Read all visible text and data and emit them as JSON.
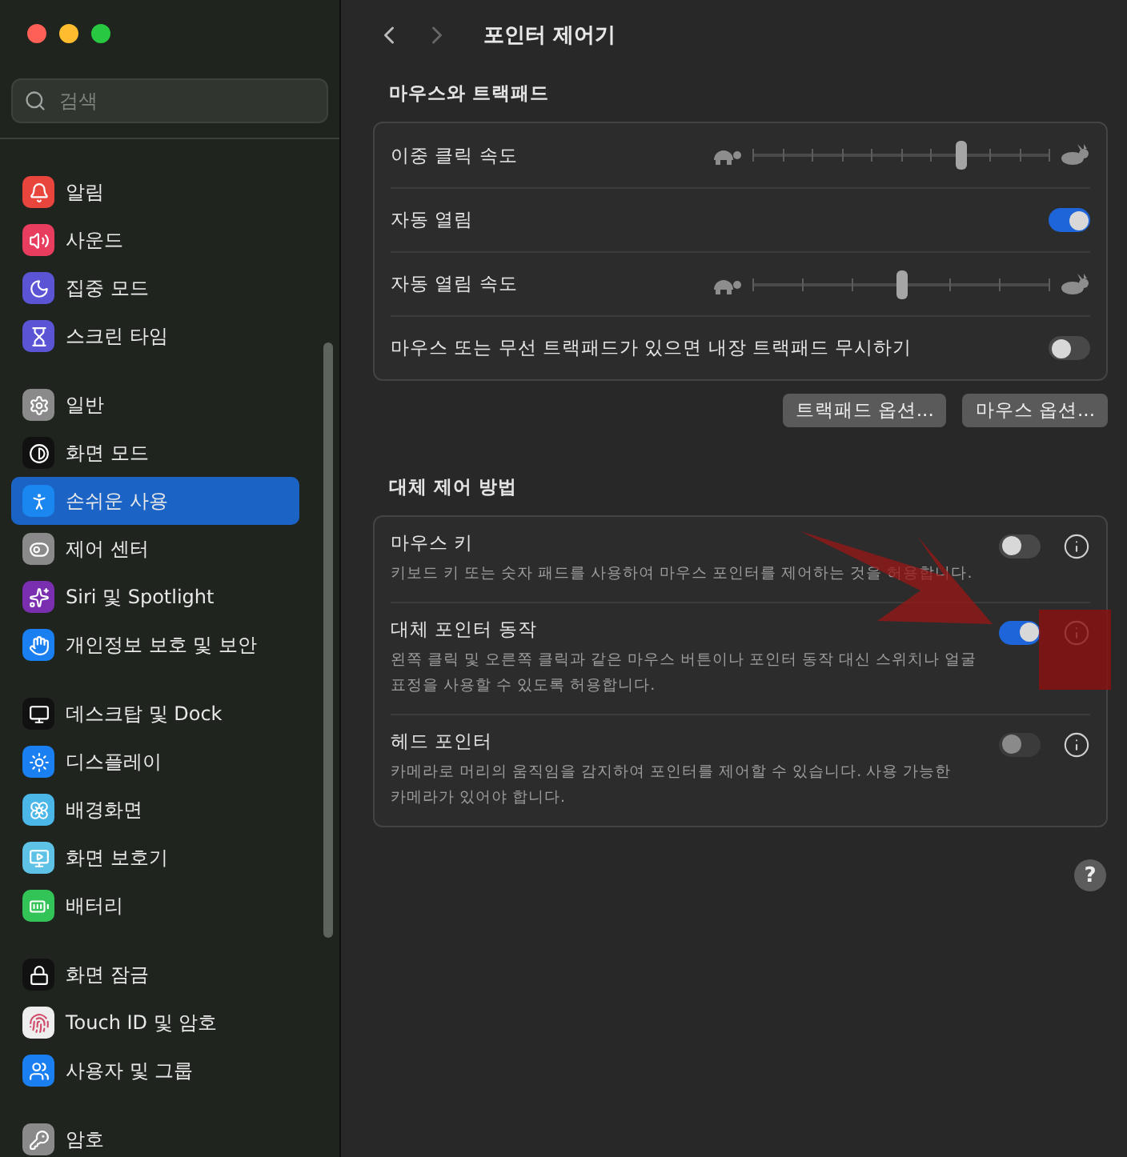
{
  "window": {
    "title": "포인터 제어기"
  },
  "sidebar": {
    "search": {
      "placeholder": "검색"
    },
    "groups": [
      [
        {
          "label": "알림",
          "selected": false
        },
        {
          "label": "사운드",
          "selected": false
        },
        {
          "label": "집중 모드",
          "selected": false
        },
        {
          "label": "스크린 타임",
          "selected": false
        }
      ],
      [
        {
          "label": "일반",
          "selected": false
        },
        {
          "label": "화면 모드",
          "selected": false
        },
        {
          "label": "손쉬운 사용",
          "selected": true
        },
        {
          "label": "제어 센터",
          "selected": false
        },
        {
          "label": "Siri 및 Spotlight",
          "selected": false
        },
        {
          "label": "개인정보 보호 및 보안",
          "selected": false
        }
      ],
      [
        {
          "label": "데스크탑 및 Dock",
          "selected": false
        },
        {
          "label": "디스플레이",
          "selected": false
        },
        {
          "label": "배경화면",
          "selected": false
        },
        {
          "label": "화면 보호기",
          "selected": false
        },
        {
          "label": "배터리",
          "selected": false
        }
      ],
      [
        {
          "label": "화면 잠금",
          "selected": false
        },
        {
          "label": "Touch ID 및 암호",
          "selected": false
        },
        {
          "label": "사용자 및 그룹",
          "selected": false
        }
      ],
      [
        {
          "label": "암호",
          "selected": false
        }
      ]
    ]
  },
  "mouse_trackpad": {
    "heading": "마우스와 트랙패드",
    "rows": [
      {
        "kind": "slider",
        "label": "이중 클릭 속도",
        "level": 0.7
      },
      {
        "kind": "toggle",
        "label": "자동 열림",
        "on": true
      },
      {
        "kind": "slider",
        "label": "자동 열림 속도",
        "level": 0.5
      },
      {
        "kind": "toggle",
        "label": "마우스 또는 무선 트랙패드가 있으면 내장 트랙패드 무시하기",
        "on": false
      }
    ],
    "buttons": [
      "트랙패드 옵션...",
      "마우스 옵션..."
    ]
  },
  "alternate_control": {
    "heading": "대체 제어 방법",
    "rows": [
      {
        "title": "마우스 키",
        "description": "키보드 키 또는 숫자 패드를 사용하여 마우스 포인터를 제어하는 것을 허용합니다.",
        "on": false,
        "disabled": false
      },
      {
        "title": "대체 포인터 동작",
        "description": "왼쪽 클릭 및 오른쪽 클릭과 같은 마우스 버튼이나 포인터 동작 대신 스위치나 얼굴 표정을 사용할 수 있도록 허용합니다.",
        "on": true,
        "disabled": false
      },
      {
        "title": "헤드 포인터",
        "description": "카메라로 머리의 움직임을 감지하여 포인터를 제어할 수 있습니다. 사용 가능한 카메라가 있어야 합니다.",
        "on": false,
        "disabled": true
      }
    ]
  },
  "help_button": "?"
}
